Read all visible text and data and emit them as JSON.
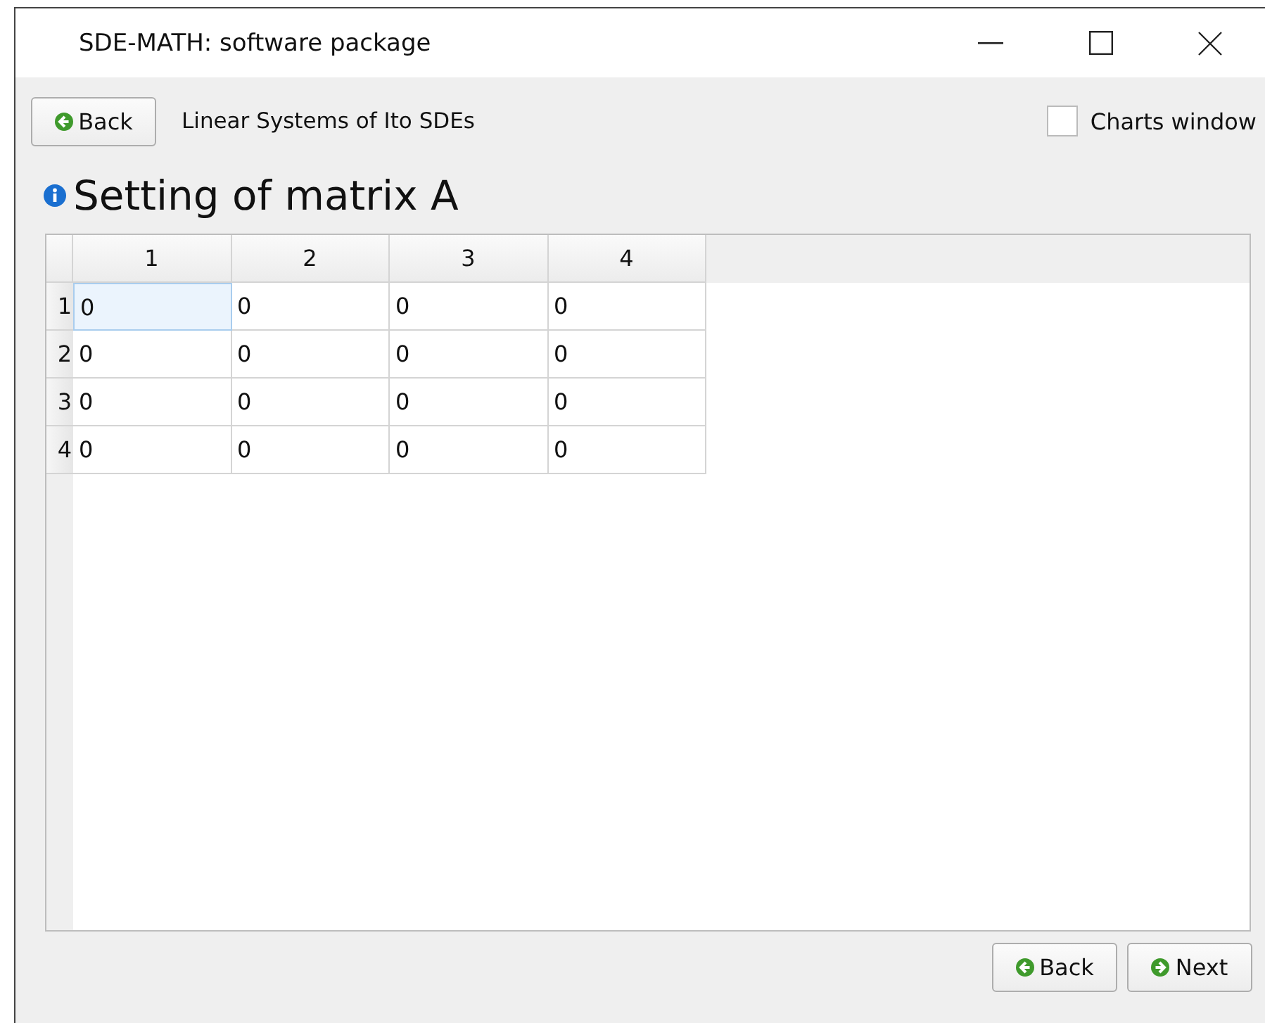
{
  "window": {
    "title": "SDE-MATH: software package"
  },
  "toolbar": {
    "back_button": "Back",
    "subtitle": "Linear Systems of Ito SDEs",
    "charts_window": {
      "label": "Charts window",
      "checked": false
    }
  },
  "heading": "Setting of matrix A",
  "table": {
    "columns": [
      "1",
      "2",
      "3",
      "4"
    ],
    "rows": [
      {
        "header": "1",
        "cells": [
          {
            "value": "0",
            "selected": true
          },
          {
            "value": "0",
            "selected": false
          },
          {
            "value": "0",
            "selected": false
          },
          {
            "value": "0",
            "selected": false
          }
        ]
      },
      {
        "header": "2",
        "cells": [
          {
            "value": "0",
            "selected": false
          },
          {
            "value": "0",
            "selected": false
          },
          {
            "value": "0",
            "selected": false
          },
          {
            "value": "0",
            "selected": false
          }
        ]
      },
      {
        "header": "3",
        "cells": [
          {
            "value": "0",
            "selected": false
          },
          {
            "value": "0",
            "selected": false
          },
          {
            "value": "0",
            "selected": false
          },
          {
            "value": "0",
            "selected": false
          }
        ]
      },
      {
        "header": "4",
        "cells": [
          {
            "value": "0",
            "selected": false
          },
          {
            "value": "0",
            "selected": false
          },
          {
            "value": "0",
            "selected": false
          },
          {
            "value": "0",
            "selected": false
          }
        ]
      }
    ]
  },
  "footer": [
    {
      "label": "Back",
      "kind": "back"
    },
    {
      "label": "Next",
      "kind": "next"
    }
  ]
}
